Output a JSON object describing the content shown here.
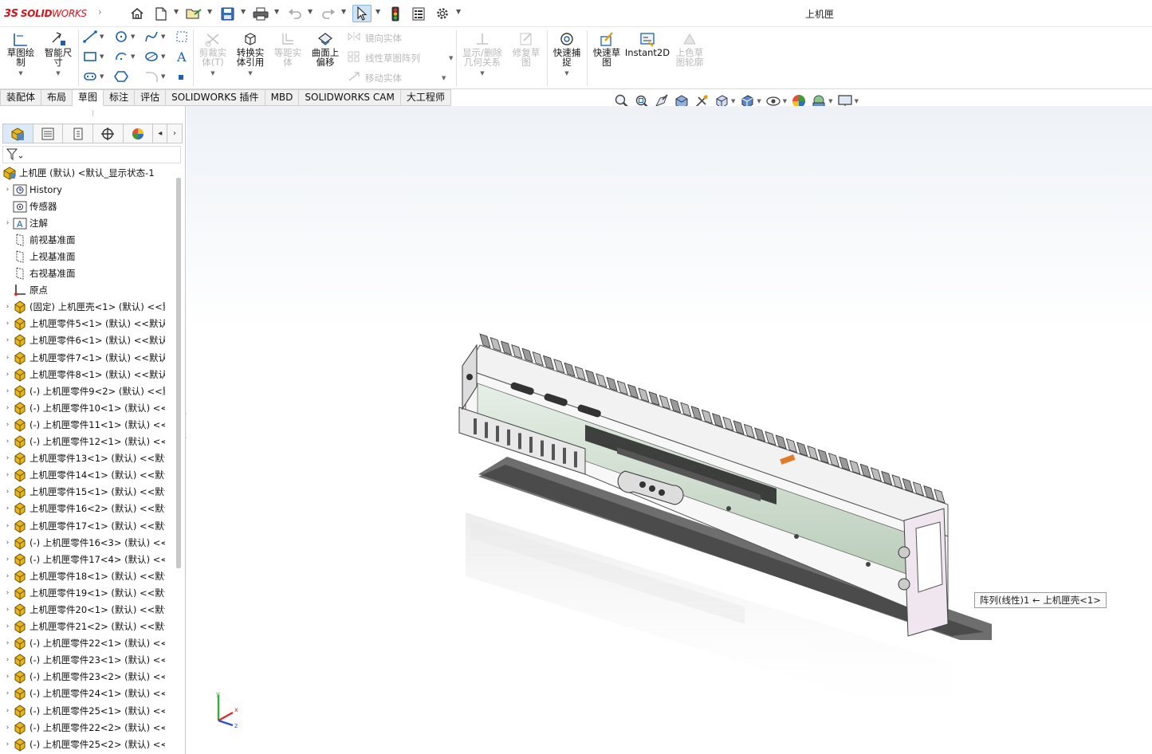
{
  "app": {
    "brand_prefix": "3S",
    "brand_solid": "SOLID",
    "brand_works": "WORKS",
    "document_title": "上机匣"
  },
  "quick_access": [
    {
      "name": "home-icon"
    },
    {
      "name": "new-document-icon"
    },
    {
      "name": "open-folder-icon"
    },
    {
      "name": "save-icon"
    },
    {
      "name": "print-icon"
    },
    {
      "name": "undo-icon"
    },
    {
      "name": "redo-icon"
    },
    {
      "name": "select-pointer-icon"
    },
    {
      "name": "rebuild-traffic-light-icon"
    },
    {
      "name": "file-properties-icon"
    },
    {
      "name": "options-gear-icon"
    }
  ],
  "ribbon": {
    "sketch": "草图绘\n制",
    "smart_dimension": "智能尺\n寸",
    "trim_entities": "剪裁实\n体(T)",
    "convert_entities": "转换实\n体引用",
    "offset_entities": "等距实\n体",
    "offset_on_surface": "曲面上\n偏移",
    "mirror_entities": "镜向实体",
    "linear_pattern": "线性草图阵列",
    "move_entities": "移动实体",
    "display_delete_relations": "显示/删除\n几何关系",
    "repair_sketch": "修复草\n图",
    "quick_snaps": "快速捕\n捉",
    "rapid_sketch": "快速草\n图",
    "instant2d": "Instant2D",
    "shaded_sketch_contours": "上色草\n图轮廓"
  },
  "tabs": [
    {
      "label": "装配体",
      "active": false
    },
    {
      "label": "布局",
      "active": false
    },
    {
      "label": "草图",
      "active": true
    },
    {
      "label": "标注",
      "active": false
    },
    {
      "label": "评估",
      "active": false
    },
    {
      "label": "SOLIDWORKS 插件",
      "active": false
    },
    {
      "label": "MBD",
      "active": false
    },
    {
      "label": "SOLIDWORKS CAM",
      "active": false
    },
    {
      "label": "大工程师",
      "active": false
    }
  ],
  "feature_tree": {
    "root": "上机匣 (默认) <默认_显示状态-1>",
    "items": [
      {
        "label": "History",
        "icon": "history-icon",
        "expand": true
      },
      {
        "label": "传感器",
        "icon": "sensor-icon",
        "expand": false
      },
      {
        "label": "注解",
        "icon": "annotation-icon",
        "expand": true
      },
      {
        "label": "前视基准面",
        "icon": "plane-icon",
        "expand": false
      },
      {
        "label": "上视基准面",
        "icon": "plane-icon",
        "expand": false
      },
      {
        "label": "右视基准面",
        "icon": "plane-icon",
        "expand": false
      },
      {
        "label": "原点",
        "icon": "origin-icon",
        "expand": false
      },
      {
        "label": "(固定) 上机匣壳<1> (默认) <<默",
        "icon": "part-icon",
        "expand": true
      },
      {
        "label": "上机匣零件5<1> (默认) <<默认",
        "icon": "part-icon",
        "expand": true
      },
      {
        "label": "上机匣零件6<1> (默认) <<默认",
        "icon": "part-icon",
        "expand": true
      },
      {
        "label": "上机匣零件7<1> (默认) <<默认",
        "icon": "part-icon",
        "expand": true
      },
      {
        "label": "上机匣零件8<1> (默认) <<默认",
        "icon": "part-icon",
        "expand": true
      },
      {
        "label": "(-) 上机匣零件9<2> (默认) <<默",
        "icon": "part-icon",
        "expand": true
      },
      {
        "label": "(-) 上机匣零件10<1> (默认) <<",
        "icon": "part-icon",
        "expand": true
      },
      {
        "label": "(-) 上机匣零件11<1> (默认) <<",
        "icon": "part-icon",
        "expand": true
      },
      {
        "label": "(-) 上机匣零件12<1> (默认) <<",
        "icon": "part-icon",
        "expand": true
      },
      {
        "label": "上机匣零件13<1> (默认) <<默认",
        "icon": "part-icon",
        "expand": true
      },
      {
        "label": "上机匣零件14<1> (默认) <<默认",
        "icon": "part-icon",
        "expand": true
      },
      {
        "label": "上机匣零件15<1> (默认) <<默认",
        "icon": "part-icon",
        "expand": true
      },
      {
        "label": "上机匣零件16<2> (默认) <<默认",
        "icon": "part-icon",
        "expand": true
      },
      {
        "label": "上机匣零件17<1> (默认) <<默认",
        "icon": "part-icon",
        "expand": true
      },
      {
        "label": "(-) 上机匣零件16<3> (默认) <<",
        "icon": "part-icon",
        "expand": true
      },
      {
        "label": "(-) 上机匣零件17<4> (默认) <<",
        "icon": "part-icon",
        "expand": true
      },
      {
        "label": "上机匣零件18<1> (默认) <<默认",
        "icon": "part-icon",
        "expand": true
      },
      {
        "label": "上机匣零件19<1> (默认) <<默认",
        "icon": "part-icon",
        "expand": true
      },
      {
        "label": "上机匣零件20<1> (默认) <<默认",
        "icon": "part-icon",
        "expand": true
      },
      {
        "label": "上机匣零件21<2> (默认) <<默认",
        "icon": "part-icon",
        "expand": true
      },
      {
        "label": "(-) 上机匣零件22<1> (默认) <<",
        "icon": "part-icon",
        "expand": true
      },
      {
        "label": "(-) 上机匣零件23<1> (默认) <<",
        "icon": "part-icon",
        "expand": true
      },
      {
        "label": "(-) 上机匣零件23<2> (默认) <<",
        "icon": "part-icon",
        "expand": true
      },
      {
        "label": "(-) 上机匣零件24<1> (默认) <<",
        "icon": "part-icon",
        "expand": true
      },
      {
        "label": "(-) 上机匣零件25<1> (默认) <<",
        "icon": "part-icon",
        "expand": true
      },
      {
        "label": "(-) 上机匣零件22<2> (默认) <<",
        "icon": "part-icon",
        "expand": true
      },
      {
        "label": "(-) 上机匣零件25<2> (默认) <<",
        "icon": "part-icon",
        "expand": true
      }
    ]
  },
  "viewport": {
    "tooltip": "阵列(线性)1 ← 上机匣壳<1>",
    "triad_axes": {
      "x": "x",
      "y": "y",
      "z": "z"
    }
  },
  "colors": {
    "brand_red": "#d4161b",
    "accent_blue": "#1e5fb0",
    "part_yellow": "#e8b620"
  }
}
